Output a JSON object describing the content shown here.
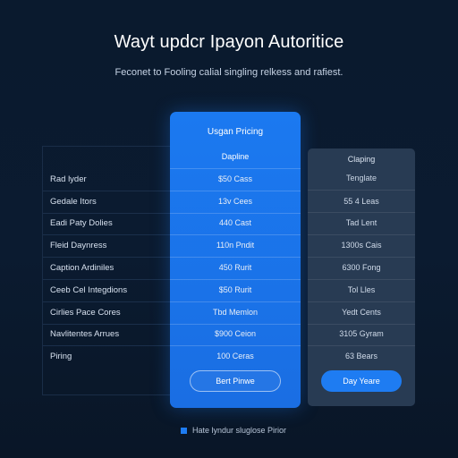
{
  "page": {
    "title": "Wayt updcr Ipayon Autoritice",
    "subtitle": "Feconet to Fooling calial singling relkess and rafiest."
  },
  "features": [
    "Rad lyder",
    "Gedale Itors",
    "Eadi Paty Dolies",
    "Fleid Daynress",
    "Caption Ardiniles",
    "Ceeb Cel Integdions",
    "Cirlies Pace Cores",
    "Navlitentes Arrues",
    "Piring"
  ],
  "plans": [
    {
      "header": "Usgan Pricing",
      "subheader": "Dapline",
      "cells": [
        "$50 Cass",
        "13v Cees",
        "440 Cast",
        "110n Pndit",
        "450 Rurit",
        "$50 Rurit",
        "Tbd Memlon",
        "$900 Ceion",
        "100 Ceras"
      ],
      "button": "Bert Pinwe",
      "featured": true
    },
    {
      "header": "Claping",
      "subheader": "Tenglate",
      "cells": [
        "55 4 Leas",
        "Tad Lent",
        "1300s Cais",
        "6300 Fong",
        "Tol Lles",
        "Yedt Cents",
        "3105 Gyram",
        "63 Bears"
      ],
      "button": "Day Yeare",
      "featured": false
    }
  ],
  "legend": {
    "label": "Hate lyndur sluglose Pirior"
  },
  "colors": {
    "background": "#0a1a2e",
    "featured": "#1b79f0",
    "alt_column": "#283b53",
    "accent": "#1e7cf2"
  }
}
